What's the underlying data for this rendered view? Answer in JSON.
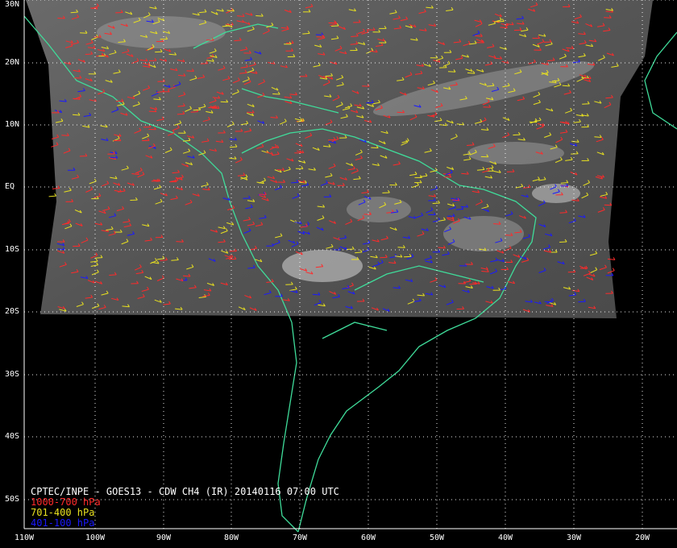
{
  "map": {
    "lat_labels": [
      "30N",
      "20N",
      "10N",
      "EQ",
      "10S",
      "20S",
      "30S",
      "40S",
      "50S"
    ],
    "lon_labels": [
      "110W",
      "100W",
      "90W",
      "80W",
      "70W",
      "60W",
      "50W",
      "40W",
      "30W",
      "20W"
    ],
    "grid": "dotted",
    "coastline_color": "#3fdc9a",
    "background": "#000000",
    "imagery": "gray infrared cloud imagery"
  },
  "caption": {
    "title": "CPTEC/INPE - GOES13 - CDW CH4 (IR) 20140116 07:00 UTC",
    "title_color": "#ffffff",
    "legend": [
      {
        "label": "1000-700 hPa",
        "color": "#ff2a2a"
      },
      {
        "label": "701-400 hPa",
        "color": "#e8e020"
      },
      {
        "label": "401-100 hPa",
        "color": "#1a1aff"
      }
    ]
  }
}
